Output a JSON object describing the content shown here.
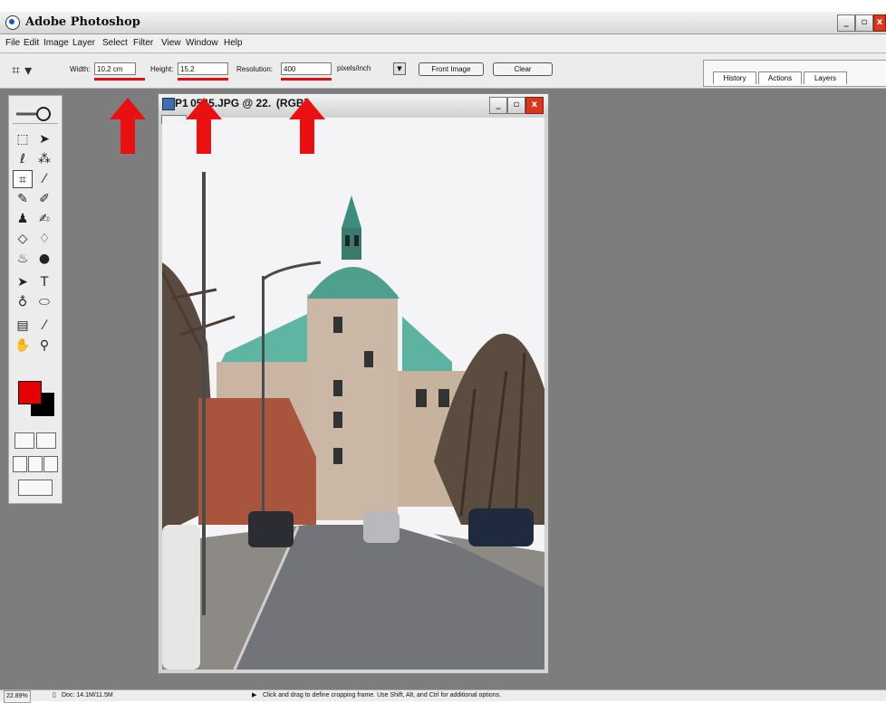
{
  "app": {
    "title": "Adobe Photoshop"
  },
  "menu": [
    "File",
    "Edit",
    "Image",
    "Layer",
    "Select",
    "Filter",
    "View",
    "Window",
    "Help"
  ],
  "options": {
    "width_label": "Width:",
    "width_value": "10,2 cm",
    "height_label": "Height:",
    "height_value": "15,2",
    "resolution_label": "Resolution:",
    "resolution_value": "400",
    "units_value": "pixels/inch",
    "front_image": "Front Image",
    "clear": "Clear"
  },
  "palette_tabs": [
    "History",
    "Actions",
    "Layers"
  ],
  "document": {
    "title": "P1 0545.JPG @ 22.  (RGB)"
  },
  "status": {
    "zoom": "22.89%",
    "doc": "Doc: 14.1M/11.5M",
    "hint": "Click and drag to define cropping frame. Use Shift, Alt, and Ctrl for additional options."
  },
  "colors": {
    "foreground": "#e40000",
    "background": "#000000",
    "annotation_arrow": "#e81010"
  },
  "toolbox_icons": [
    "marquee-icon",
    "move-icon",
    "lasso-icon",
    "magic-wand-icon",
    "crop-icon",
    "slice-icon",
    "healing-icon",
    "brush-icon",
    "stamp-icon",
    "history-brush-icon",
    "eraser-icon",
    "bucket-icon",
    "blur-icon",
    "dodge-icon",
    "path-select-icon",
    "type-icon",
    "pen-icon",
    "shape-icon",
    "notes-icon",
    "eyedropper-icon",
    "hand-icon",
    "zoom-icon"
  ]
}
